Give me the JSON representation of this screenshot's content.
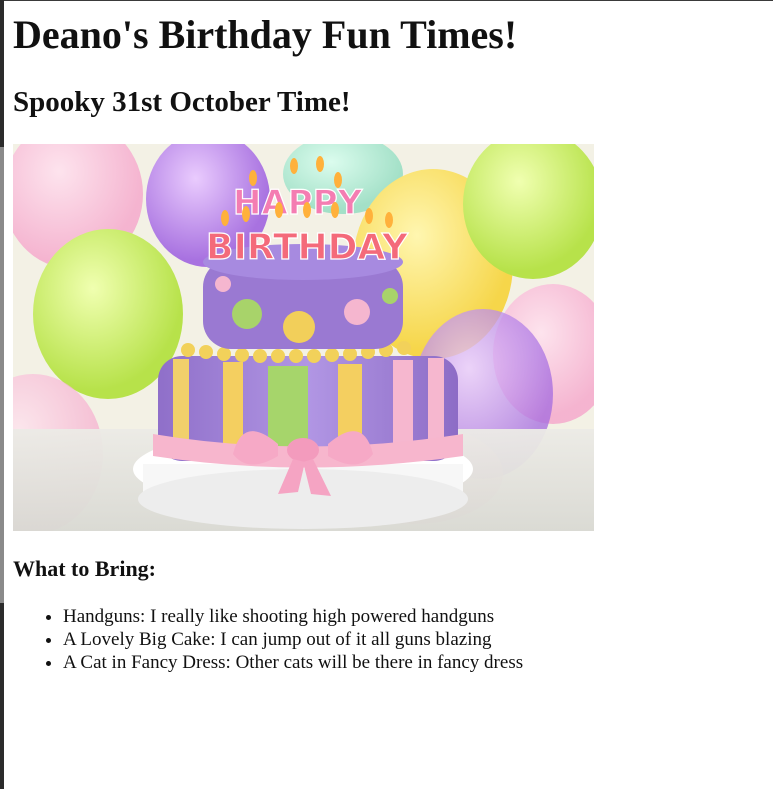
{
  "page": {
    "title": "Deano's Birthday Fun Times!",
    "subtitle": "Spooky 31st October Time!",
    "section_heading": "What to Bring:"
  },
  "image": {
    "icon": "birthday-cake-image",
    "cake_topper_line1": "HAPPY",
    "cake_topper_line2": "BIRTHDAY"
  },
  "bring_list": [
    {
      "text": "Handguns: I really like shooting high powered handguns"
    },
    {
      "text": "A Lovely Big Cake: I can jump out of it all guns blazing"
    },
    {
      "text": "A Cat in Fancy Dress: Other cats will be there in fancy dress"
    }
  ],
  "colors": {
    "text": "#111111",
    "background": "#ffffff"
  }
}
